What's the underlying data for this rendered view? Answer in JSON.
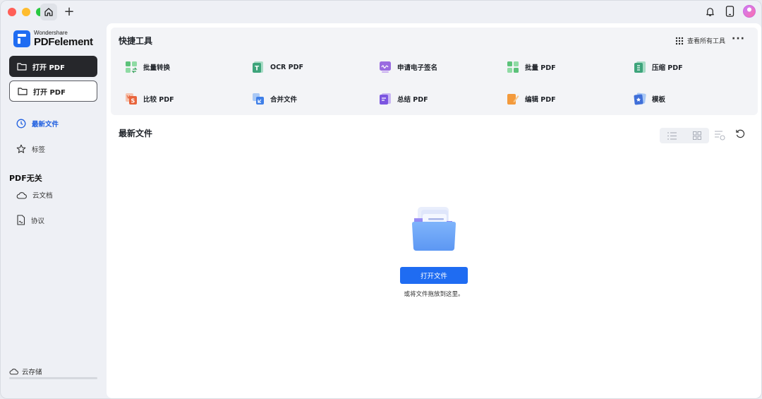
{
  "window": {
    "tabs": [
      {
        "icon": "home-icon"
      }
    ],
    "new_tab": "+"
  },
  "topbar": {
    "icons": [
      "bell-icon",
      "tablet-icon",
      "avatar"
    ]
  },
  "brand": {
    "company": "Wondershare",
    "product": "PDFelement",
    "color": "#1f6cf2"
  },
  "sidebar": {
    "open_pdf_primary": "打开 PDF",
    "open_pdf_secondary": "打开 PDF",
    "nav": [
      {
        "label": "最新文件",
        "icon": "clock-icon",
        "active": true
      },
      {
        "label": "标签",
        "icon": "star-icon",
        "active": false
      }
    ],
    "section_title": "PDF无关",
    "section_items": [
      {
        "label": "云文档",
        "icon": "cloud-icon"
      },
      {
        "label": "协议",
        "icon": "document-sign-icon"
      }
    ],
    "storage_label": "云存储"
  },
  "quick_tools": {
    "title": "快捷工具",
    "view_all": "查看所有工具",
    "more": "···",
    "items": [
      {
        "label": "批量转换",
        "icon": "batch-convert-icon"
      },
      {
        "label": "OCR PDF",
        "icon": "ocr-icon"
      },
      {
        "label": "申请电子签名",
        "icon": "esign-icon"
      },
      {
        "label": "批量 PDF",
        "icon": "batch-pdf-icon"
      },
      {
        "label": "压缩 PDF",
        "icon": "compress-icon"
      },
      {
        "label": "比较 PDF",
        "icon": "compare-icon"
      },
      {
        "label": "合并文件",
        "icon": "merge-icon"
      },
      {
        "label": "总结 PDF",
        "icon": "summarize-icon"
      },
      {
        "label": "编辑 PDF",
        "icon": "edit-icon"
      },
      {
        "label": "模板",
        "icon": "template-icon"
      }
    ]
  },
  "recent": {
    "title": "最新文件",
    "open_button": "打开文件",
    "drop_hint": "或将文件拖放到这里。"
  }
}
